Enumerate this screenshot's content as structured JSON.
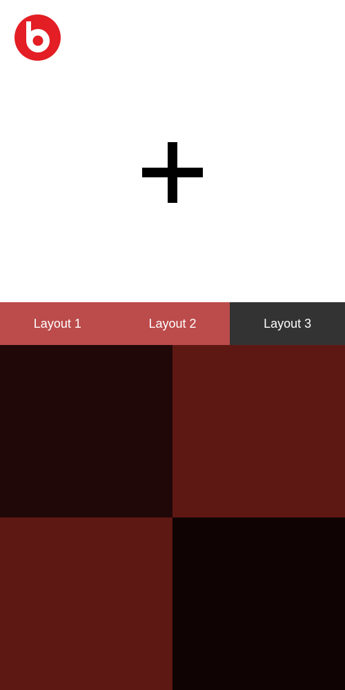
{
  "header": {
    "logo_icon": "beats-logo-icon",
    "logo_color": "#E31E24",
    "add_icon": "plus-icon"
  },
  "tabs": [
    {
      "label": "Layout 1",
      "color": "#BC4B4B",
      "active": false
    },
    {
      "label": "Layout 2",
      "color": "#BC4B4B",
      "active": false
    },
    {
      "label": "Layout 3",
      "color": "#333333",
      "active": true
    }
  ],
  "tiles": [
    {
      "color": "#200808"
    },
    {
      "color": "#5E1814"
    },
    {
      "color": "#5E1814"
    },
    {
      "color": "#0F0303"
    }
  ]
}
